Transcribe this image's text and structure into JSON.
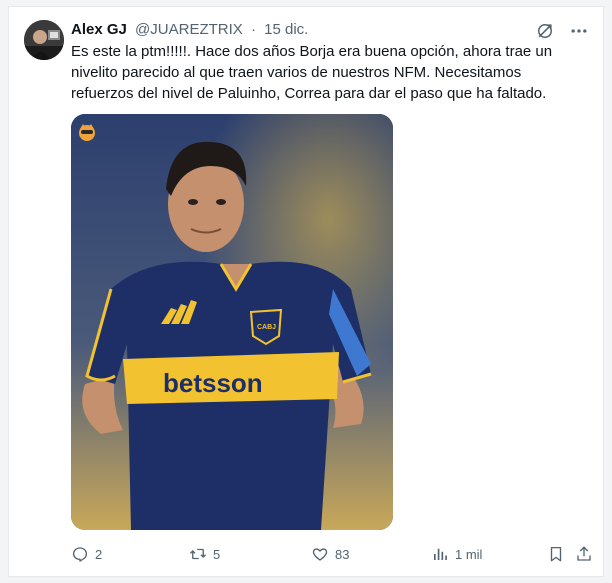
{
  "tweet": {
    "author_name": "Alex GJ",
    "handle": "@JUAREZTRIX",
    "separator": "·",
    "date": "15 dic.",
    "text_lines": [
      "Es este la ptm!!!!!. Hace dos años Borja era buena opción, ahora trae un",
      "nivelito parecido al que traen varios de nuestros NFM. Necesitamos",
      "refuerzos del nivel de  Paluinho, Correa para dar el paso que ha faltado."
    ],
    "media": {
      "jersey_sponsor": "betsson",
      "crest_text": "CABJ"
    }
  },
  "actions": {
    "replies": "2",
    "reposts": "5",
    "likes": "83",
    "views": "1 mil"
  },
  "icons": {
    "top": [
      "grok-icon",
      "more-icon"
    ],
    "actions": [
      "reply-icon",
      "repost-icon",
      "like-icon",
      "views-icon",
      "bookmark-icon",
      "share-icon"
    ],
    "media_badge": "emoji-badge-icon"
  },
  "colors": {
    "secondary_text": "#536471",
    "jersey_navy": "#1d2f66",
    "jersey_gold": "#f2c230"
  }
}
